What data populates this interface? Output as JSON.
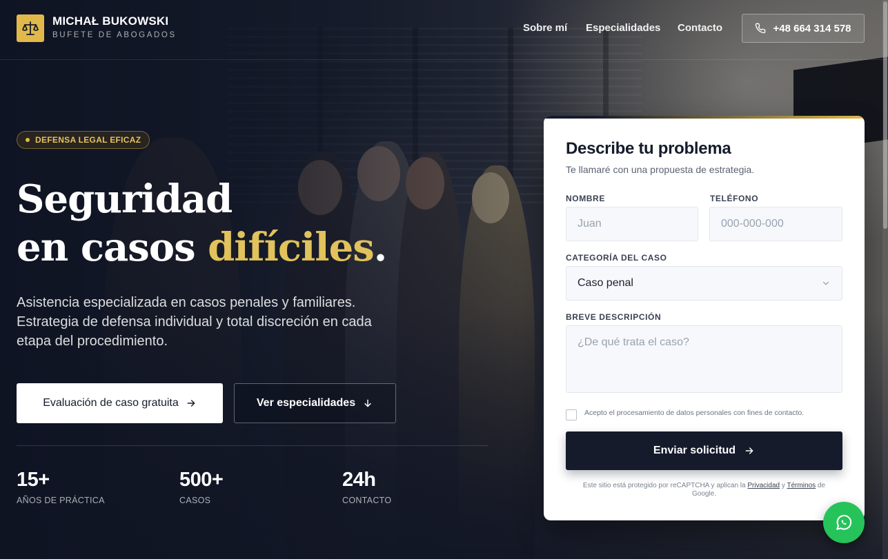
{
  "colors": {
    "accent": "#e1b94a",
    "navy": "#151b2b",
    "whatsapp": "#26c35b"
  },
  "header": {
    "brand_name": "MICHAŁ BUKOWSKI",
    "brand_sub": "BUFETE DE ABOGADOS",
    "logo_icon": "scales-icon",
    "nav": [
      "Sobre mí",
      "Especialidades",
      "Contacto"
    ],
    "phone": "+48 664 314 578",
    "phone_icon": "phone-icon"
  },
  "hero": {
    "badge": "DEFENSA LEGAL EFICAZ",
    "headline_line1": "Seguridad",
    "headline_line2_pre": "en casos ",
    "headline_line2_accent": "difíciles",
    "headline_line2_post": ".",
    "lead": "Asistencia especializada en casos penales y familiares. Estrategia de defensa individual y total discreción en cada etapa del procedimiento.",
    "primary_cta": "Evaluación de caso gratuita",
    "secondary_cta": "Ver especialidades",
    "stats": [
      {
        "value": "15+",
        "label": "AÑOS DE PRÁCTICA"
      },
      {
        "value": "500+",
        "label": "CASOS"
      },
      {
        "value": "24h",
        "label": "CONTACTO"
      }
    ]
  },
  "form": {
    "title": "Describe tu problema",
    "subtitle": "Te llamaré con una propuesta de estrategia.",
    "name_label": "NOMBRE",
    "name_placeholder": "Juan",
    "phone_label": "TELÉFONO",
    "phone_placeholder": "000-000-000",
    "category_label": "CATEGORÍA DEL CASO",
    "category_value": "Caso penal",
    "description_label": "BREVE DESCRIPCIÓN",
    "description_placeholder": "¿De qué trata el caso?",
    "consent": "Acepto el procesamiento de datos personales con fines de contacto.",
    "submit": "Enviar solicitud",
    "recaptcha_pre": "Este sitio está protegido por reCAPTCHA y aplican la ",
    "recaptcha_privacy": "Privacidad",
    "recaptcha_and": " y ",
    "recaptcha_terms": "Términos",
    "recaptcha_post": " de Google."
  },
  "whatsapp_icon": "whatsapp-icon"
}
